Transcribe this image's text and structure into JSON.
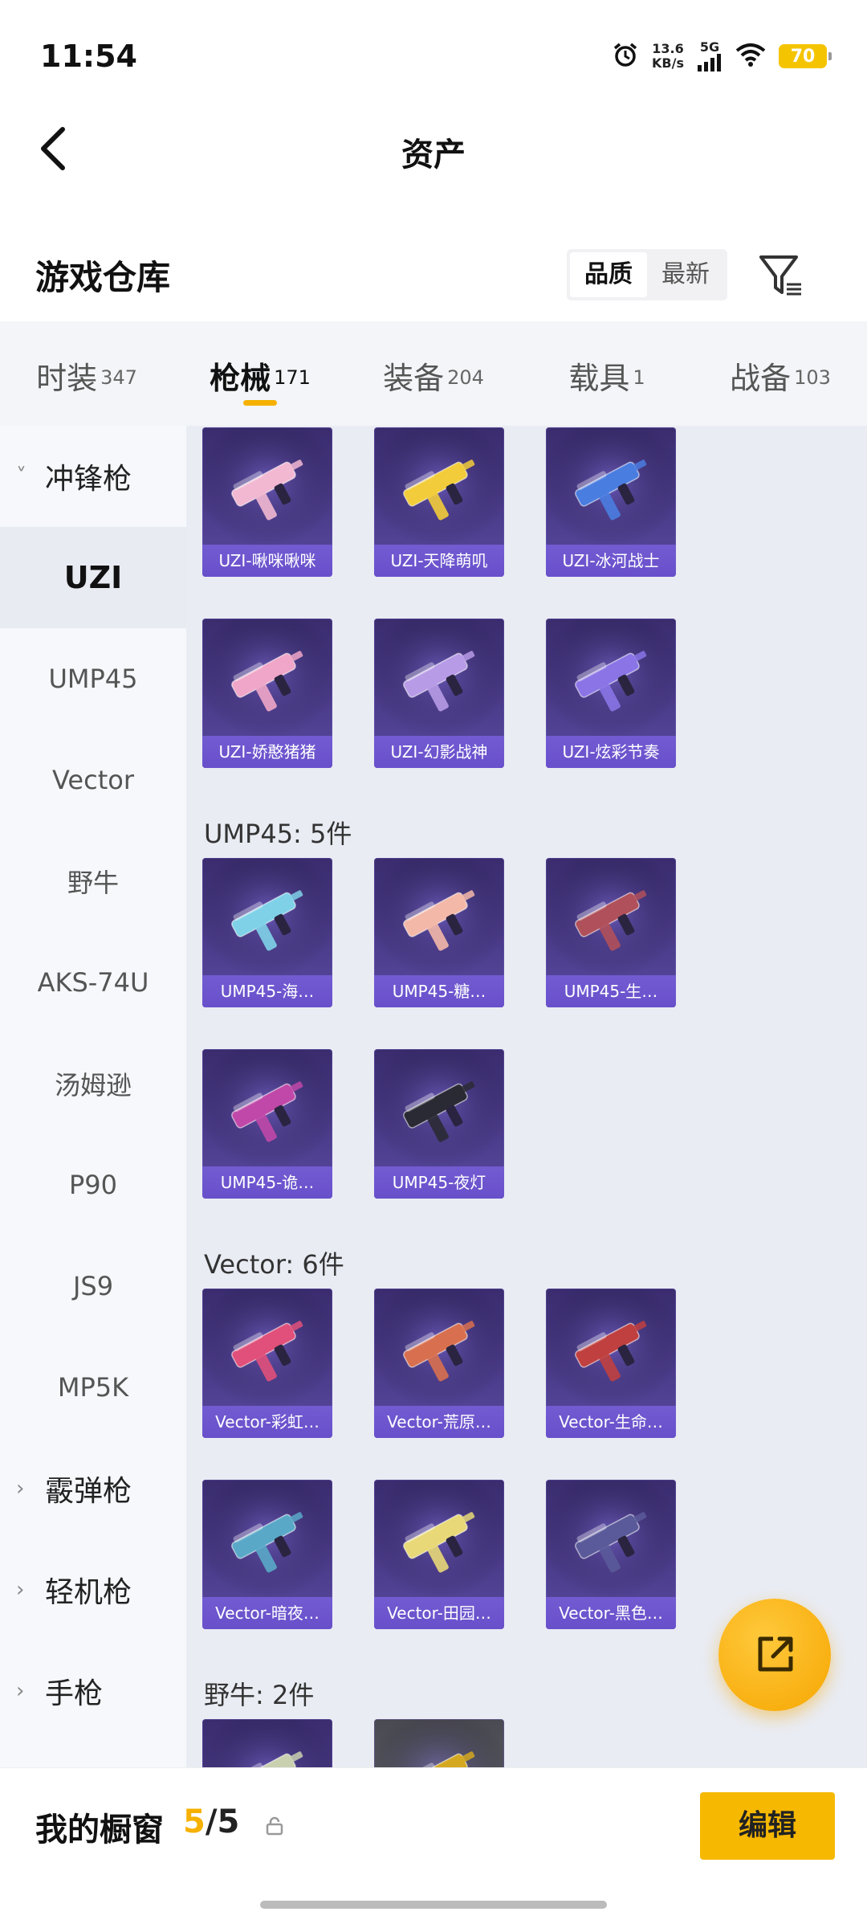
{
  "status_bar": {
    "time": "11:54",
    "net_speed_value": "13.6",
    "net_speed_unit": "KB/s",
    "network": "5G",
    "battery": "70"
  },
  "header": {
    "title": "资产"
  },
  "warehouse": {
    "title": "游戏仓库",
    "sort_options": [
      {
        "label": "品质",
        "active": true
      },
      {
        "label": "最新",
        "active": false
      }
    ]
  },
  "category_tabs": [
    {
      "label": "时装",
      "count": "347",
      "active": false
    },
    {
      "label": "枪械",
      "count": "171",
      "active": true
    },
    {
      "label": "装备",
      "count": "204",
      "active": false
    },
    {
      "label": "载具",
      "count": "1",
      "active": false
    },
    {
      "label": "战备",
      "count": "103",
      "active": false
    }
  ],
  "sidebar": [
    {
      "label": "冲锋枪",
      "type": "group",
      "expanded": true
    },
    {
      "label": "UZI",
      "type": "item",
      "active": true
    },
    {
      "label": "UMP45",
      "type": "item"
    },
    {
      "label": "Vector",
      "type": "item"
    },
    {
      "label": "野牛",
      "type": "item"
    },
    {
      "label": "AKS-74U",
      "type": "item"
    },
    {
      "label": "汤姆逊",
      "type": "item"
    },
    {
      "label": "P90",
      "type": "item"
    },
    {
      "label": "JS9",
      "type": "item"
    },
    {
      "label": "MP5K",
      "type": "item"
    },
    {
      "label": "霰弹枪",
      "type": "group",
      "expanded": false
    },
    {
      "label": "轻机枪",
      "type": "group",
      "expanded": false
    },
    {
      "label": "手枪",
      "type": "group",
      "expanded": false
    }
  ],
  "sections": [
    {
      "title": "",
      "items": [
        {
          "name": "UZI-啾咪啾咪",
          "color": "#f2b8d2"
        },
        {
          "name": "UZI-天降萌叽",
          "color": "#f2cc3a"
        },
        {
          "name": "UZI-冰河战士",
          "color": "#4a7de0"
        },
        {
          "name": "UZI-娇憨猪猪",
          "color": "#f0a6c8"
        },
        {
          "name": "UZI-幻影战神",
          "color": "#b79be6"
        },
        {
          "name": "UZI-炫彩节奏",
          "color": "#8a74e6"
        }
      ]
    },
    {
      "title": "UMP45: 5件",
      "items": [
        {
          "name": "UMP45-海…",
          "color": "#7fd1e8"
        },
        {
          "name": "UMP45-糖…",
          "color": "#f4b8a8"
        },
        {
          "name": "UMP45-生…",
          "color": "#b0505a"
        },
        {
          "name": "UMP45-诡…",
          "color": "#c048a8"
        },
        {
          "name": "UMP45-夜灯",
          "color": "#2a2a34"
        }
      ]
    },
    {
      "title": "Vector: 6件",
      "items": [
        {
          "name": "Vector-彩虹…",
          "color": "#e0507a"
        },
        {
          "name": "Vector-荒原…",
          "color": "#d87050"
        },
        {
          "name": "Vector-生命…",
          "color": "#c04040"
        },
        {
          "name": "Vector-暗夜…",
          "color": "#5aa8c8"
        },
        {
          "name": "Vector-田园…",
          "color": "#e8d878"
        },
        {
          "name": "Vector-黑色…",
          "color": "#5a5a9a"
        }
      ]
    },
    {
      "title": "野牛: 2件",
      "items": [
        {
          "name": "",
          "color": "#c8d0b0",
          "variant": "purple"
        },
        {
          "name": "",
          "color": "#d4a820",
          "variant": "grey"
        }
      ]
    }
  ],
  "bottom_bar": {
    "label": "我的橱窗",
    "current": "5",
    "separator": "/",
    "total": "5",
    "edit_label": "编辑"
  },
  "colors": {
    "accent": "#f6b800",
    "card_purple": "#4b3b8a",
    "tab_underline": "#f6b100"
  }
}
